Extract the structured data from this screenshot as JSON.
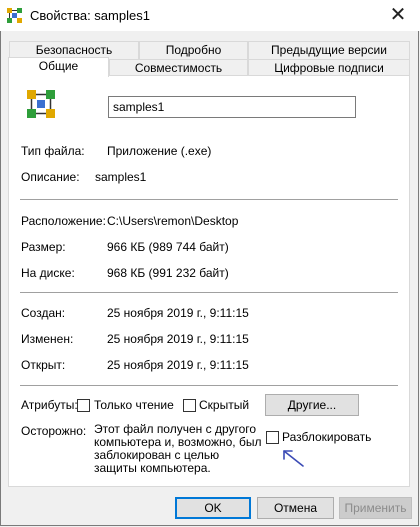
{
  "window": {
    "title": "Свойства: samples1",
    "close_glyph": "✕"
  },
  "tabs": {
    "row1": [
      "Безопасность",
      "Подробно",
      "Предыдущие версии"
    ],
    "row2": [
      "Общие",
      "Совместимость",
      "Цифровые подписи"
    ],
    "active": "Общие"
  },
  "general": {
    "file_name": "samples1",
    "file_type_label": "Тип файла:",
    "file_type_value": "Приложение (.exe)",
    "description_label": "Описание:",
    "description_value": "samples1",
    "location_label": "Расположение:",
    "location_value": "C:\\Users\\remon\\Desktop",
    "size_label": "Размер:",
    "size_value": "966 КБ (989 744 байт)",
    "disk_label": "На диске:",
    "disk_value": "968 КБ (991 232 байт)",
    "created_label": "Создан:",
    "created_value": "25 ноября 2019 г., 9:11:15",
    "modified_label": "Изменен:",
    "modified_value": "25 ноября 2019 г., 9:11:15",
    "opened_label": "Открыт:",
    "opened_value": "25 ноября 2019 г., 9:11:15",
    "attributes_label": "Атрибуты:",
    "readonly_label": "Только чтение",
    "readonly_checked": false,
    "hidden_label": "Скрытый",
    "hidden_checked": false,
    "other_button": "Другие...",
    "caution_label": "Осторожно:",
    "caution_text": "Этот файл получен с другого компьютера и, возможно, был заблокирован с целью защиты компьютера.",
    "unblock_label": "Разблокировать",
    "unblock_checked": false
  },
  "footer": {
    "ok": "OK",
    "cancel": "Отмена",
    "apply": "Применить"
  },
  "icons": {
    "window": "app-file-icon",
    "file": "app-file-icon",
    "annotation": "arrow-pointer-icon"
  },
  "colors": {
    "accent": "#0078d7",
    "annotation_arrow": "#3b4bb5"
  }
}
